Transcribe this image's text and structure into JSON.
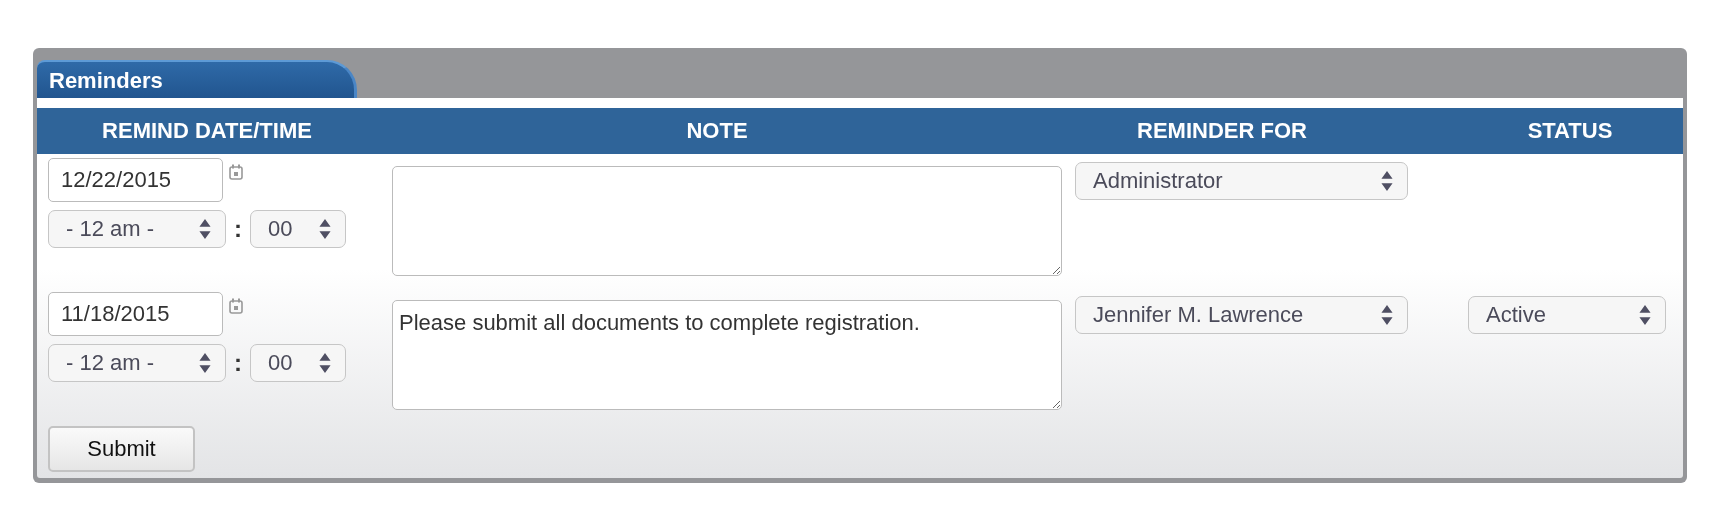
{
  "panel": {
    "tab": "Reminders"
  },
  "columns": [
    "REMIND DATE/TIME",
    "NOTE",
    "REMINDER FOR",
    "STATUS"
  ],
  "rows": [
    {
      "date": "12/22/2015",
      "hour": "- 12 am -",
      "separator": ":",
      "minute": "00",
      "note": "",
      "reminder_for": "Administrator"
    },
    {
      "date": "11/18/2015",
      "hour": "- 12 am -",
      "separator": ":",
      "minute": "00",
      "note": "Please submit all documents to complete registration.",
      "reminder_for": "Jennifer M. Lawrence",
      "status": "Active"
    }
  ],
  "submit": "Submit"
}
